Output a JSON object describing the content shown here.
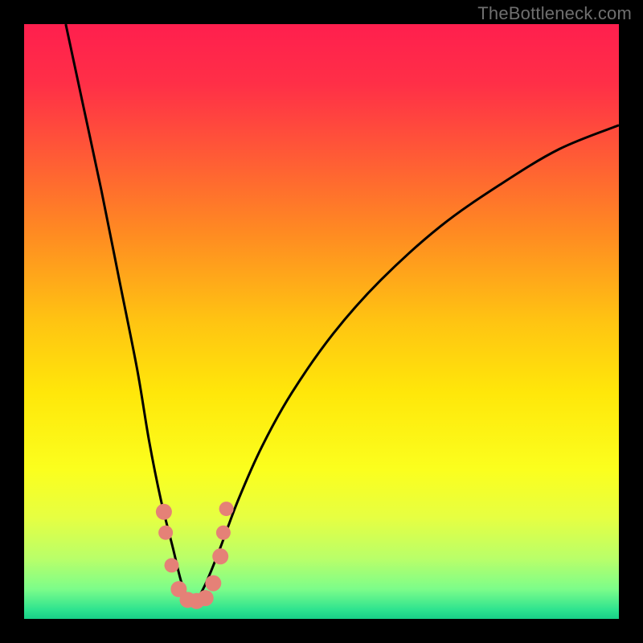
{
  "watermark": "TheBottleneck.com",
  "gradient": {
    "stops": [
      {
        "offset": 0.0,
        "color": "#ff1f4e"
      },
      {
        "offset": 0.1,
        "color": "#ff2f47"
      },
      {
        "offset": 0.22,
        "color": "#ff5a36"
      },
      {
        "offset": 0.35,
        "color": "#ff8a22"
      },
      {
        "offset": 0.5,
        "color": "#ffc412"
      },
      {
        "offset": 0.62,
        "color": "#ffe70a"
      },
      {
        "offset": 0.75,
        "color": "#fbff1e"
      },
      {
        "offset": 0.83,
        "color": "#e6ff42"
      },
      {
        "offset": 0.9,
        "color": "#b8ff6a"
      },
      {
        "offset": 0.95,
        "color": "#7cfd8a"
      },
      {
        "offset": 0.985,
        "color": "#2de38f"
      },
      {
        "offset": 1.0,
        "color": "#18cf87"
      }
    ]
  },
  "chart_data": {
    "type": "line",
    "title": "",
    "xlabel": "",
    "ylabel": "",
    "xlim": [
      0,
      100
    ],
    "ylim": [
      0,
      100
    ],
    "x_at_minimum": 28,
    "series": [
      {
        "name": "curve",
        "x": [
          7,
          10,
          13,
          16,
          19,
          21,
          23,
          25,
          26.5,
          28,
          29.5,
          31,
          33,
          36,
          40,
          45,
          52,
          60,
          70,
          80,
          90,
          100
        ],
        "y": [
          100,
          86,
          72,
          57,
          42,
          30,
          20,
          12,
          6,
          3,
          4,
          7,
          12,
          20,
          29,
          38,
          48,
          57,
          66,
          73,
          79,
          83
        ]
      }
    ],
    "markers": [
      {
        "x": 23.5,
        "y": 18,
        "r": 10,
        "color": "#e58177"
      },
      {
        "x": 23.8,
        "y": 14.5,
        "r": 9,
        "color": "#e58177"
      },
      {
        "x": 24.8,
        "y": 9,
        "r": 9,
        "color": "#e58177"
      },
      {
        "x": 26.0,
        "y": 5,
        "r": 10,
        "color": "#e58177"
      },
      {
        "x": 27.5,
        "y": 3.2,
        "r": 10,
        "color": "#e58177"
      },
      {
        "x": 29.0,
        "y": 3.0,
        "r": 10,
        "color": "#e58177"
      },
      {
        "x": 30.5,
        "y": 3.5,
        "r": 10,
        "color": "#e58177"
      },
      {
        "x": 31.8,
        "y": 6.0,
        "r": 10,
        "color": "#e58177"
      },
      {
        "x": 33.0,
        "y": 10.5,
        "r": 10,
        "color": "#e58177"
      },
      {
        "x": 33.5,
        "y": 14.5,
        "r": 9,
        "color": "#e58177"
      },
      {
        "x": 34.0,
        "y": 18.5,
        "r": 9,
        "color": "#e58177"
      }
    ]
  }
}
